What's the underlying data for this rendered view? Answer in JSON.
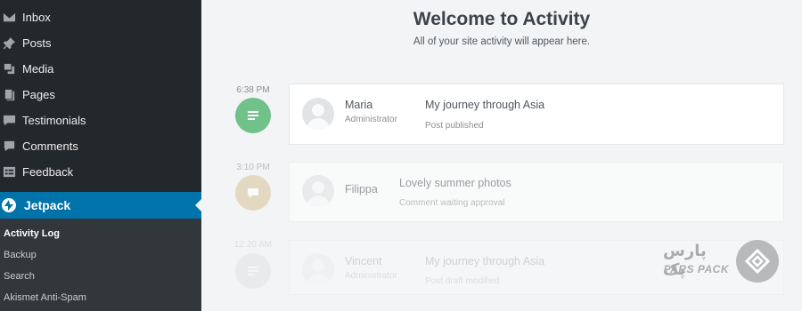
{
  "sidebar": {
    "items": [
      {
        "label": "Inbox",
        "icon": "envelope-icon"
      },
      {
        "label": "Posts",
        "icon": "pushpin-icon"
      },
      {
        "label": "Media",
        "icon": "media-icon"
      },
      {
        "label": "Pages",
        "icon": "pages-icon"
      },
      {
        "label": "Testimonials",
        "icon": "testimonial-icon"
      },
      {
        "label": "Comments",
        "icon": "comment-icon"
      },
      {
        "label": "Feedback",
        "icon": "feedback-icon"
      }
    ],
    "active": {
      "label": "Jetpack",
      "icon": "jetpack-icon"
    },
    "submenu": [
      "Activity Log",
      "Backup",
      "Search",
      "Akismet Anti-Spam"
    ],
    "accent_color": "#0073aa"
  },
  "main": {
    "title": "Welcome to Activity",
    "subtitle": "All of your site activity will appear here.",
    "events": [
      {
        "time": "6:38 PM",
        "icon": "post-icon",
        "color": "#70c18a",
        "actor": "Maria",
        "role": "Administrator",
        "title": "My journey through Asia",
        "description": "Post published"
      },
      {
        "time": "3:10 PM",
        "icon": "comment-icon",
        "color": "#d6c39a",
        "actor": "Filippa",
        "role": "",
        "title": "Lovely summer photos",
        "description": "Comment waiting approval"
      },
      {
        "time": "12:20 AM",
        "icon": "post-icon",
        "color": "#c8cbce",
        "actor": "Vincent",
        "role": "Administrator",
        "title": "My journey through Asia",
        "description": "Post draft modified"
      }
    ]
  },
  "watermark": {
    "fa": "پارس پک",
    "en": "PARS PACK"
  }
}
